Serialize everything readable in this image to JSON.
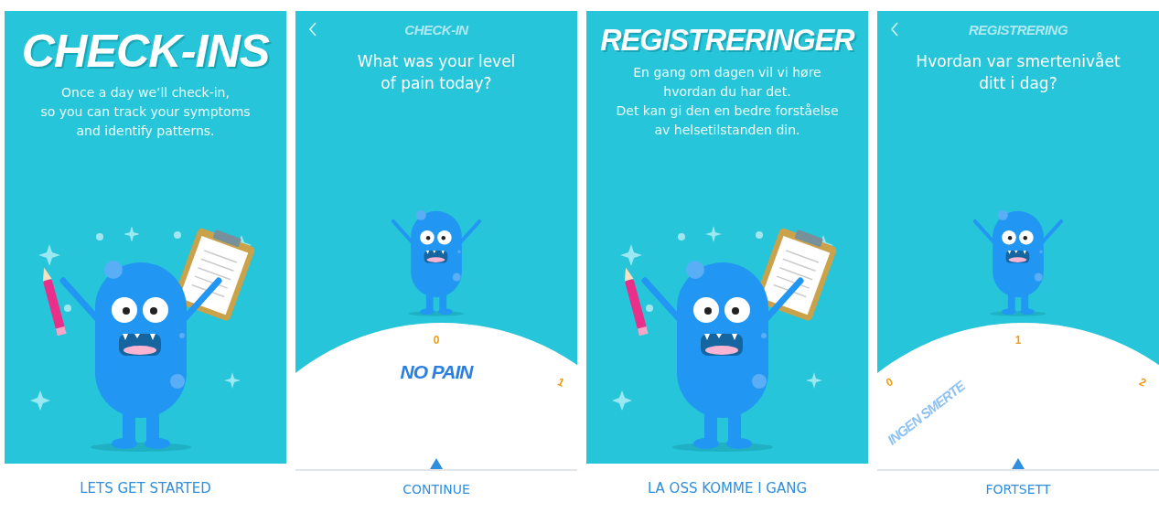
{
  "screens": [
    {
      "kind": "intro",
      "title": "CHECK-INS",
      "text": "Once a day we’ll check-in,\nso you can track your symptoms\nand identify patterns.",
      "button": "LETS GET STARTED"
    },
    {
      "kind": "question",
      "header": "CHECK-IN",
      "question": "What was your level\nof pain today?",
      "ticks": [
        {
          "label": "0",
          "kind": "top"
        },
        {
          "label": "1",
          "kind": "right"
        }
      ],
      "dial_label": {
        "text": "NO PAIN",
        "kind": "center"
      },
      "button": "CONTINUE"
    },
    {
      "kind": "intro",
      "title": "REGISTRERINGER",
      "text": "En gang om dagen vil vi høre\nhvordan du har det.\nDet kan gi den en bedre forståelse\nav helsetilstanden din.",
      "button": "LA OSS KOMME I GANG"
    },
    {
      "kind": "question",
      "header": "REGISTRERING",
      "question": "Hvordan var smertenivået\nditt i dag?",
      "ticks": [
        {
          "label": "0",
          "kind": "left"
        },
        {
          "label": "1",
          "kind": "top"
        },
        {
          "label": "2",
          "kind": "right"
        }
      ],
      "dial_label": {
        "text": "INGEN SMERTE",
        "kind": "left"
      },
      "button": "FORTSETT"
    }
  ]
}
